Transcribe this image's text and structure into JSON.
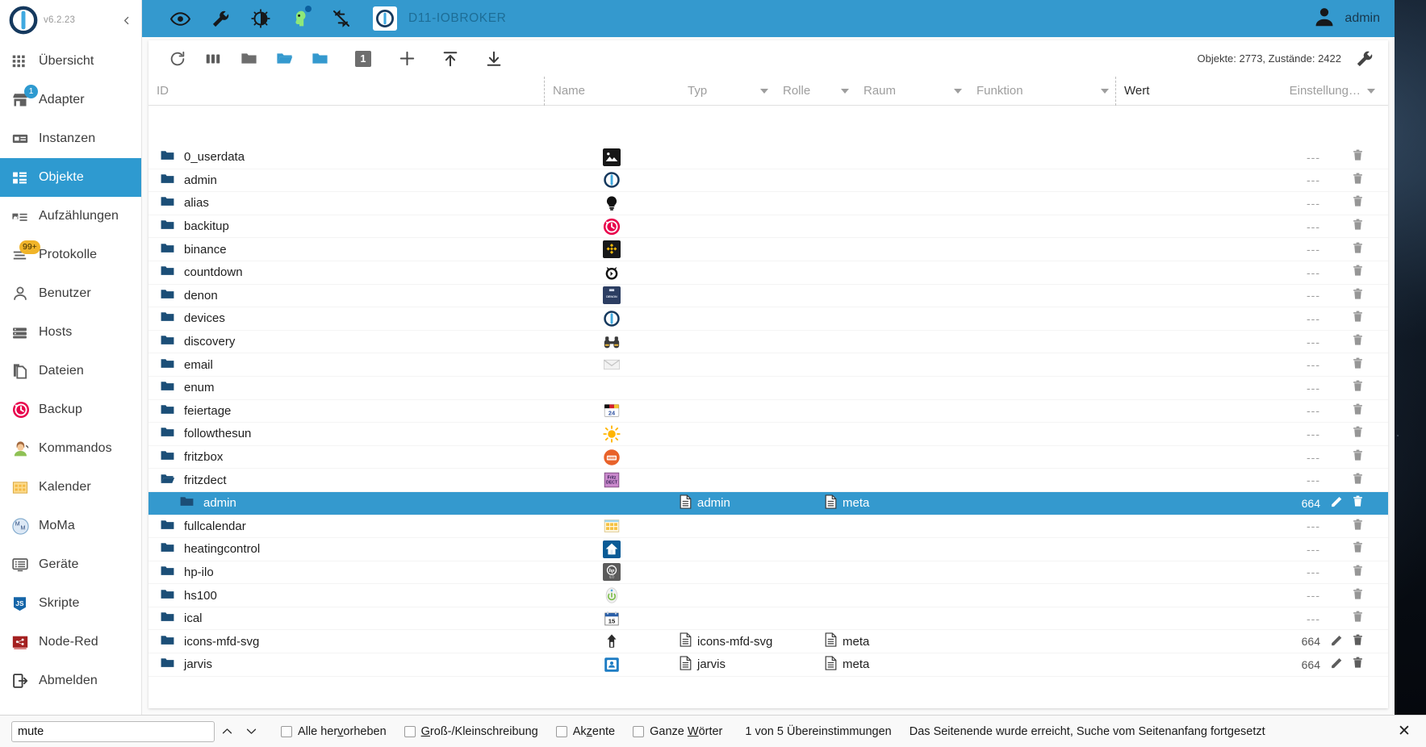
{
  "sidebar": {
    "version": "v6.2.23",
    "logo_icon": "iobroker-logo",
    "collapse_icon": "chevron-left-icon",
    "items": [
      {
        "label": "Übersicht",
        "icon": "grid-icon",
        "badge": null,
        "active": false
      },
      {
        "label": "Adapter",
        "icon": "store-icon",
        "badge": "1",
        "active": false
      },
      {
        "label": "Instanzen",
        "icon": "instances-icon",
        "badge": null,
        "active": false
      },
      {
        "label": "Objekte",
        "icon": "objects-icon",
        "badge": null,
        "active": true
      },
      {
        "label": "Aufzählungen",
        "icon": "enums-icon",
        "badge": null,
        "active": false
      },
      {
        "label": "Protokolle",
        "icon": "logs-icon",
        "badge": "99+",
        "active": false
      },
      {
        "label": "Benutzer",
        "icon": "user-icon",
        "badge": null,
        "active": false
      },
      {
        "label": "Hosts",
        "icon": "hosts-icon",
        "badge": null,
        "active": false
      },
      {
        "label": "Dateien",
        "icon": "files-icon",
        "badge": null,
        "active": false
      },
      {
        "label": "Backup",
        "icon": "backup-icon",
        "badge": null,
        "active": false
      },
      {
        "label": "Kommandos",
        "icon": "commands-icon",
        "badge": null,
        "active": false
      },
      {
        "label": "Kalender",
        "icon": "calendar-icon",
        "badge": null,
        "active": false
      },
      {
        "label": "MoMa",
        "icon": "moma-icon",
        "badge": null,
        "active": false
      },
      {
        "label": "Geräte",
        "icon": "devices-icon",
        "badge": null,
        "active": false
      },
      {
        "label": "Skripte",
        "icon": "javascript-icon",
        "badge": null,
        "active": false
      },
      {
        "label": "Node-Red",
        "icon": "nodered-icon",
        "badge": null,
        "active": false
      },
      {
        "label": "Abmelden",
        "icon": "logout-icon",
        "badge": null,
        "active": false
      }
    ]
  },
  "topbar": {
    "background": "#3499ce",
    "icons": [
      "eye-icon",
      "wrench-icon",
      "brightness-icon",
      "expert-mode-icon",
      "no-sync-icon"
    ],
    "host_logo_icon": "iobroker-logo",
    "host_name": "D11-IOBROKER",
    "user_icon": "avatar-icon",
    "user_name": "admin"
  },
  "table_toolbar": {
    "buttons": [
      {
        "name": "refresh-button",
        "icon": "refresh-icon"
      },
      {
        "name": "columns-button",
        "icon": "columns-icon"
      },
      {
        "name": "collapse-all-button",
        "icon": "folder-closed-icon"
      },
      {
        "name": "expand-all-button",
        "icon": "folder-open-icon"
      },
      {
        "name": "expand-one-button",
        "icon": "folder-blue-icon"
      },
      {
        "name": "depth-level-button",
        "icon": "level-badge-icon",
        "label": "1"
      },
      {
        "name": "add-object-button",
        "icon": "plus-icon"
      },
      {
        "name": "import-button",
        "icon": "upload-icon"
      },
      {
        "name": "export-button",
        "icon": "download-icon"
      }
    ],
    "stats": "Objekte: 2773, Zustände: 2422",
    "settings_icon": "wrench-icon"
  },
  "table": {
    "columns": [
      {
        "label": "ID",
        "filter": false,
        "dropdown": false
      },
      {
        "label": "Name",
        "filter": true,
        "dropdown": false
      },
      {
        "label": "Typ",
        "filter": true,
        "dropdown": true
      },
      {
        "label": "Rolle",
        "filter": true,
        "dropdown": true
      },
      {
        "label": "Raum",
        "filter": true,
        "dropdown": true
      },
      {
        "label": "Funktion",
        "filter": true,
        "dropdown": true
      },
      {
        "label": "Wert",
        "filter": false,
        "dropdown": false
      },
      {
        "label": "Einstellung…",
        "filter": false,
        "dropdown": true
      }
    ],
    "rows": [
      {
        "id": "0_userdata",
        "icon": "image-icon",
        "name": "",
        "typ": "",
        "value": "---",
        "selected": false,
        "indent": false,
        "folder": "closed",
        "editable": false
      },
      {
        "id": "admin",
        "icon": "iobroker-icon",
        "name": "",
        "typ": "",
        "value": "---",
        "selected": false,
        "indent": false,
        "folder": "closed",
        "editable": false
      },
      {
        "id": "alias",
        "icon": "bulb-icon",
        "name": "",
        "typ": "",
        "value": "---",
        "selected": false,
        "indent": false,
        "folder": "closed",
        "editable": false
      },
      {
        "id": "backitup",
        "icon": "backup-clock-icon",
        "name": "",
        "typ": "",
        "value": "---",
        "selected": false,
        "indent": false,
        "folder": "closed",
        "editable": false
      },
      {
        "id": "binance",
        "icon": "binance-icon",
        "name": "",
        "typ": "",
        "value": "---",
        "selected": false,
        "indent": false,
        "folder": "closed",
        "editable": false
      },
      {
        "id": "countdown",
        "icon": "alarmclock-icon",
        "name": "",
        "typ": "",
        "value": "---",
        "selected": false,
        "indent": false,
        "folder": "closed",
        "editable": false
      },
      {
        "id": "denon",
        "icon": "denon-icon",
        "name": "",
        "typ": "",
        "value": "---",
        "selected": false,
        "indent": false,
        "folder": "closed",
        "editable": false
      },
      {
        "id": "devices",
        "icon": "iobroker-icon",
        "name": "",
        "typ": "",
        "value": "---",
        "selected": false,
        "indent": false,
        "folder": "closed",
        "editable": false
      },
      {
        "id": "discovery",
        "icon": "binoculars-icon",
        "name": "",
        "typ": "",
        "value": "---",
        "selected": false,
        "indent": false,
        "folder": "closed",
        "editable": false
      },
      {
        "id": "email",
        "icon": "envelope-icon",
        "name": "",
        "typ": "",
        "value": "---",
        "selected": false,
        "indent": false,
        "folder": "closed",
        "editable": false
      },
      {
        "id": "enum",
        "icon": "",
        "name": "",
        "typ": "",
        "value": "---",
        "selected": false,
        "indent": false,
        "folder": "closed",
        "editable": false
      },
      {
        "id": "feiertage",
        "icon": "holidays-icon",
        "name": "",
        "typ": "",
        "value": "---",
        "selected": false,
        "indent": false,
        "folder": "closed",
        "editable": false
      },
      {
        "id": "followthesun",
        "icon": "sun-icon",
        "name": "",
        "typ": "",
        "value": "---",
        "selected": false,
        "indent": false,
        "folder": "closed",
        "editable": false
      },
      {
        "id": "fritzbox",
        "icon": "fritzbox-icon",
        "name": "",
        "typ": "",
        "value": "---",
        "selected": false,
        "indent": false,
        "folder": "closed",
        "editable": false
      },
      {
        "id": "fritzdect",
        "icon": "fritzdect-icon",
        "name": "",
        "typ": "",
        "value": "---",
        "selected": false,
        "indent": false,
        "folder": "open",
        "editable": false
      },
      {
        "id": "admin",
        "icon": "",
        "name": "admin",
        "typ": "meta",
        "value": "664",
        "selected": true,
        "indent": true,
        "folder": "closed",
        "editable": true
      },
      {
        "id": "fullcalendar",
        "icon": "fullcalendar-icon",
        "name": "",
        "typ": "",
        "value": "---",
        "selected": false,
        "indent": false,
        "folder": "closed",
        "editable": false
      },
      {
        "id": "heatingcontrol",
        "icon": "heating-icon",
        "name": "",
        "typ": "",
        "value": "---",
        "selected": false,
        "indent": false,
        "folder": "closed",
        "editable": false
      },
      {
        "id": "hp-ilo",
        "icon": "hp-icon",
        "name": "",
        "typ": "",
        "value": "---",
        "selected": false,
        "indent": false,
        "folder": "closed",
        "editable": false
      },
      {
        "id": "hs100",
        "icon": "hs100-icon",
        "name": "",
        "typ": "",
        "value": "---",
        "selected": false,
        "indent": false,
        "folder": "closed",
        "editable": false
      },
      {
        "id": "ical",
        "icon": "ical-icon",
        "name": "",
        "typ": "",
        "value": "---",
        "selected": false,
        "indent": false,
        "folder": "closed",
        "editable": false
      },
      {
        "id": "icons-mfd-svg",
        "icon": "mfd-icon",
        "name": "icons-mfd-svg",
        "typ": "meta",
        "value": "664",
        "selected": false,
        "indent": false,
        "folder": "closed",
        "editable": true
      },
      {
        "id": "jarvis",
        "icon": "jarvis-icon",
        "name": "jarvis",
        "typ": "meta",
        "value": "664",
        "selected": false,
        "indent": false,
        "folder": "closed",
        "editable": true
      }
    ],
    "edit_icon": "pencil-icon",
    "delete_icon": "trash-icon"
  },
  "findbar": {
    "query": "mute",
    "placeholder": "",
    "prev_icon": "chevron-up-icon",
    "next_icon": "chevron-down-icon",
    "options": [
      {
        "label": "Alle hervorheben",
        "checked": false,
        "accel": "v"
      },
      {
        "label": "Groß-/Kleinschreibung",
        "checked": false,
        "accel": "G"
      },
      {
        "label": "Akzente",
        "checked": false,
        "accel": "z"
      },
      {
        "label": "Ganze Wörter",
        "checked": false,
        "accel": "W"
      }
    ],
    "matches": "1 von 5 Übereinstimmungen",
    "status": "Das Seitenende wurde erreicht, Suche vom Seitenanfang fortgesetzt",
    "close_icon": "close-icon"
  }
}
